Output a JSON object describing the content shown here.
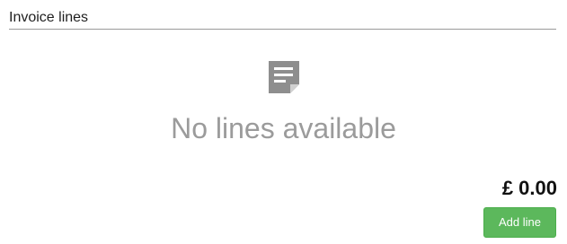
{
  "section": {
    "title": "Invoice lines"
  },
  "empty_state": {
    "icon": "document-icon",
    "message": "No lines available"
  },
  "summary": {
    "total": "£ 0.00"
  },
  "actions": {
    "add_line_label": "Add line"
  },
  "colors": {
    "accent_green": "#5cb85c",
    "muted_gray": "#9b9b9b"
  }
}
